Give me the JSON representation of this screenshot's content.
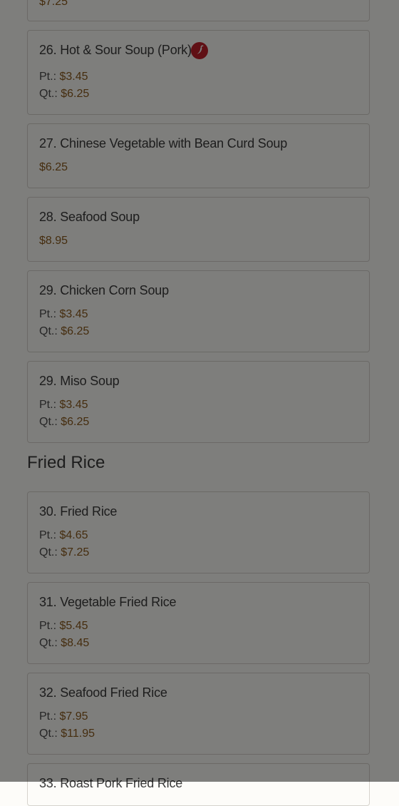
{
  "colors": {
    "page_background": "#fdfcf9",
    "card_border": "#d6d3cd",
    "price_accent": "#8a5a1d",
    "spicy_icon": "#c0202a",
    "overlay": "rgba(0,0,0,0.5)"
  },
  "partial_top_card": {
    "price": "$7.25"
  },
  "items": {
    "i26": {
      "title": "26. Hot & Sour Soup (Pork)",
      "icon": "chili-pepper-icon",
      "pt_label": "Pt.:",
      "pt_price": "$3.45",
      "qt_label": "Qt.:",
      "qt_price": "$6.25"
    },
    "i27": {
      "title": "27. Chinese Vegetable with Bean Curd Soup",
      "price": "$6.25"
    },
    "i28": {
      "title": "28. Seafood Soup",
      "price": "$8.95"
    },
    "i29a": {
      "title": "29. Chicken Corn Soup",
      "pt_label": "Pt.:",
      "pt_price": "$3.45",
      "qt_label": "Qt.:",
      "qt_price": "$6.25"
    },
    "i29b": {
      "title": "29. Miso Soup",
      "pt_label": "Pt.:",
      "pt_price": "$3.45",
      "qt_label": "Qt.:",
      "qt_price": "$6.25"
    },
    "i30": {
      "title": "30. Fried Rice",
      "pt_label": "Pt.:",
      "pt_price": "$4.65",
      "qt_label": "Qt.:",
      "qt_price": "$7.25"
    },
    "i31": {
      "title": "31. Vegetable Fried Rice",
      "pt_label": "Pt.:",
      "pt_price": "$5.45",
      "qt_label": "Qt.:",
      "qt_price": "$8.45"
    },
    "i32": {
      "title": "32. Seafood Fried Rice",
      "pt_label": "Pt.:",
      "pt_price": "$7.95",
      "qt_label": "Qt.:",
      "qt_price": "$11.95"
    },
    "i33": {
      "title": "33. Roast Pork Fried Rice"
    }
  },
  "sections": {
    "fried_rice": "Fried Rice"
  }
}
